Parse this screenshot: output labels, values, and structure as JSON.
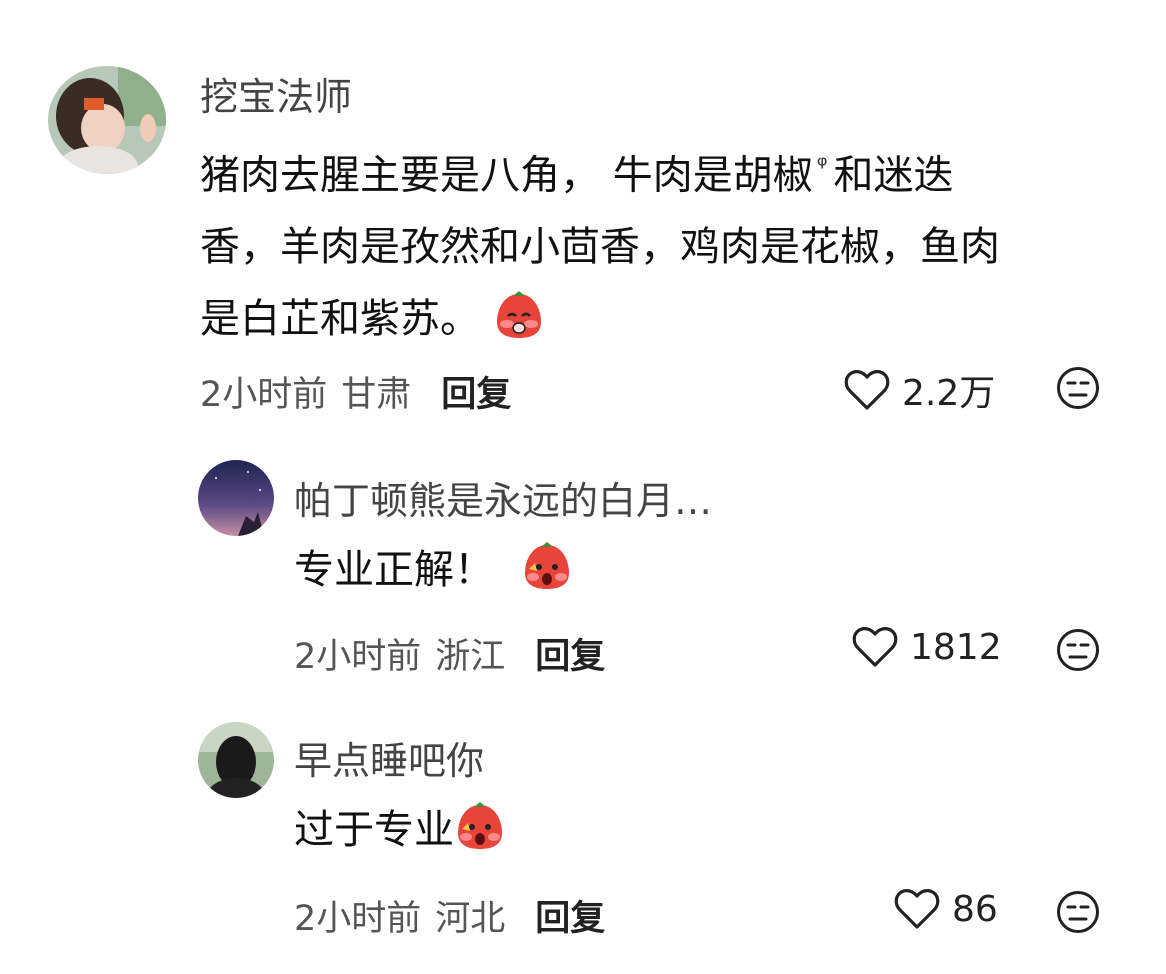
{
  "comments": [
    {
      "username": "挖宝法师",
      "text_line1_a": "猪肉去腥主要是八角， 牛肉是胡椒",
      "search_glyph": "ᵠ",
      "text_line1_b": "和迷迭",
      "text_line2": "香，羊肉是孜然和小茴香，鸡肉是花椒，鱼肉",
      "text_line3": "是白芷和紫苏。",
      "time": "2小时前",
      "location": "甘肃",
      "reply_label": "回复",
      "likes": "2.2万"
    },
    {
      "username": "帕丁顿熊是永远的白月…",
      "text": "专业正解！",
      "time": "2小时前",
      "location": "浙江",
      "reply_label": "回复",
      "likes": "1812"
    },
    {
      "username": "早点睡吧你",
      "text": "过于专业",
      "time": "2小时前",
      "location": "河北",
      "reply_label": "回复",
      "likes": "86"
    }
  ],
  "colors": {
    "text": "#111111",
    "meta": "#555555",
    "emoji_red": "#e8443a"
  }
}
